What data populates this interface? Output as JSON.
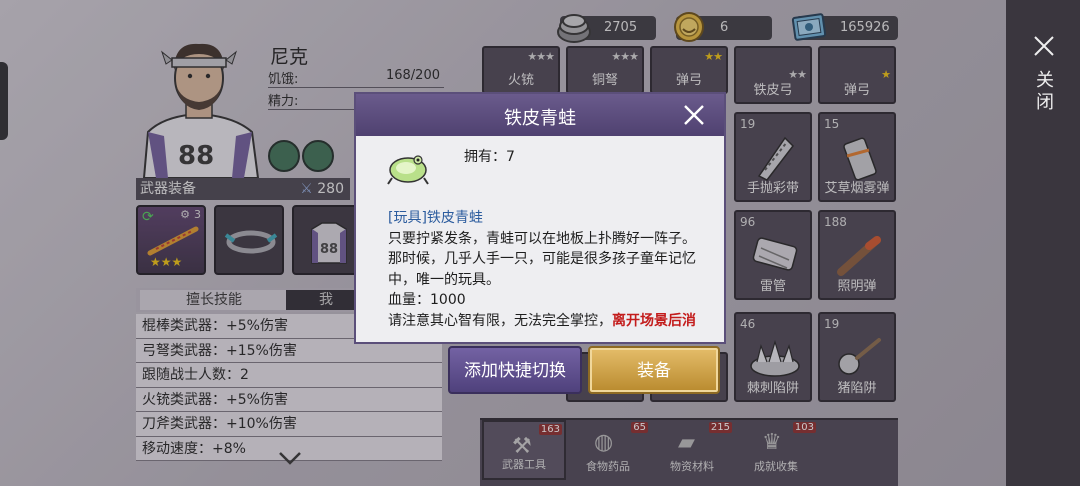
{
  "resources": [
    {
      "icon": "scrap-metal-icon",
      "value": "2705"
    },
    {
      "icon": "coin-icon",
      "value": "6"
    },
    {
      "icon": "money-icon",
      "value": "165926"
    }
  ],
  "character": {
    "name": "尼克",
    "stats": [
      {
        "label": "饥饿:",
        "value": "168/200"
      },
      {
        "label": "精力:",
        "value": ""
      }
    ]
  },
  "weapons": {
    "title": "武器装备",
    "attack": "280",
    "slot1_level": "3",
    "slot1_stars": "★★★"
  },
  "skills": {
    "tabs": [
      "擅长技能",
      "我"
    ],
    "items": [
      "棍棒类武器：+5%伤害",
      "弓弩类武器：+15%伤害",
      "跟随战士人数：2",
      "火铳类武器：+5%伤害",
      "刀斧类武器：+10%伤害",
      "移动速度：+8%"
    ]
  },
  "inventory": {
    "top_row": [
      {
        "label": "火铳",
        "stars": "★★★"
      },
      {
        "label": "铜弩",
        "stars": "★★★"
      },
      {
        "label": "弹弓",
        "stars": "★★"
      },
      {
        "label": "铁皮弓",
        "stars": "★★"
      },
      {
        "label": "弹弓",
        "stars": "★"
      }
    ],
    "right_items": [
      {
        "count": "19",
        "label": "手抛彩带"
      },
      {
        "count": "15",
        "label": "艾草烟雾弹"
      },
      {
        "count": "96",
        "label": "雷管"
      },
      {
        "count": "188",
        "label": "照明弹"
      },
      {
        "count": "46",
        "label": "棘刺陷阱"
      },
      {
        "count": "19",
        "label": "猪陷阱"
      }
    ]
  },
  "bottom_tabs": [
    {
      "label": "武器工具",
      "badge": "163"
    },
    {
      "label": "食物药品",
      "badge": "65"
    },
    {
      "label": "物资材料",
      "badge": "215"
    },
    {
      "label": "成就收集",
      "badge": "103"
    }
  ],
  "close_label": "关闭",
  "popup": {
    "title": "铁皮青蛙",
    "owned": "拥有：7",
    "tag": "[玩具]铁皮青蛙",
    "description": "只要拧紧发条，青蛙可以在地板上扑腾好一阵子。那时候，几乎人手一只，可能是很多孩子童年记忆中，唯一的玩具。",
    "hp": "血量：1000",
    "warning_prefix": "请注意其心智有限，无法完全掌控，",
    "warning_red": "离开场景后消失",
    "btn_quick": "添加快捷切换",
    "btn_equip": "装备"
  }
}
